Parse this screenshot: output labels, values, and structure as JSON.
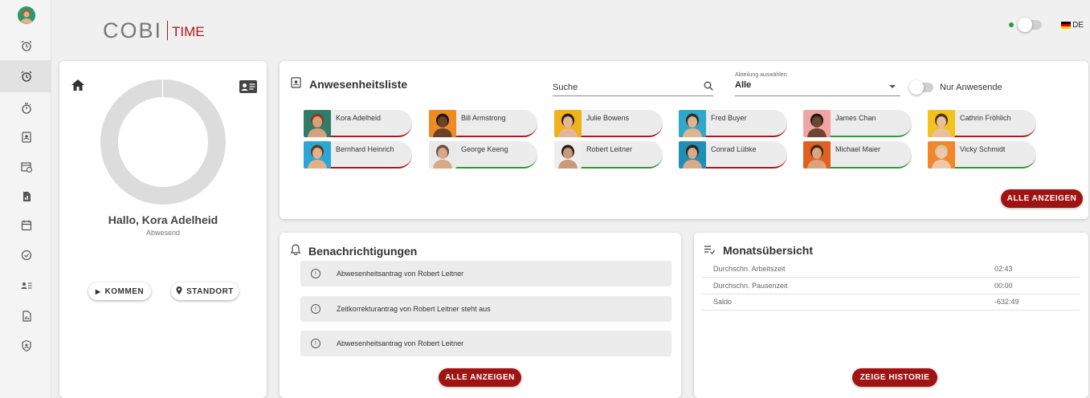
{
  "header": {
    "logo_main": "COBI",
    "logo_sub": "TIME",
    "language": "DE",
    "status_color": "#2e9b3a"
  },
  "sidebar": {
    "items": [
      {
        "icon": "alarm-clock-icon"
      },
      {
        "icon": "alarm-clock-icon",
        "active": true
      },
      {
        "icon": "stopwatch-icon"
      },
      {
        "icon": "contacts-book-icon"
      },
      {
        "icon": "calendar-clock-icon"
      },
      {
        "icon": "report-file-icon"
      },
      {
        "icon": "calendar-icon"
      },
      {
        "icon": "check-circle-icon"
      },
      {
        "icon": "user-list-icon"
      },
      {
        "icon": "chart-file-icon"
      },
      {
        "icon": "shield-user-icon"
      }
    ]
  },
  "profile": {
    "greeting": "Hallo, Kora Adelheid",
    "status": "Abwesend",
    "buttons": {
      "come": "KOMMEN",
      "location": "STANDORT"
    }
  },
  "presence": {
    "title": "Anwesenheitsliste",
    "search_placeholder": "Suche",
    "department_caption": "Abteilung auswählen",
    "department_value": "Alle",
    "only_present_label": "Nur Anwesende",
    "show_all": "ALLE ANZEIGEN",
    "people": [
      {
        "name": "Kora Adelheid",
        "status": "red",
        "bg": "#2e7d6b",
        "skin": "#d9a17a",
        "hair": "#8a3b1a"
      },
      {
        "name": "Bill Armstrong",
        "status": "red",
        "bg": "#f08a24",
        "skin": "#6b4128",
        "hair": "#1a1a1a"
      },
      {
        "name": "Julie Bowens",
        "status": "red",
        "bg": "#f0b21b",
        "skin": "#e3b699",
        "hair": "#2a1f1a"
      },
      {
        "name": "Fred Buyer",
        "status": "red",
        "bg": "#2fa8c9",
        "skin": "#e0b48f",
        "hair": "#3a2a1f"
      },
      {
        "name": "James Chan",
        "status": "green",
        "bg": "#f2a3a3",
        "skin": "#6e4630",
        "hair": "#1a1a1a"
      },
      {
        "name": "Cathrin Fröhlich",
        "status": "red",
        "bg": "#f4c21d",
        "skin": "#e8c0a0",
        "hair": "#4a3322"
      },
      {
        "name": "Bernhard Heinrich",
        "status": "red",
        "bg": "#2aa7d8",
        "skin": "#e2b08a",
        "hair": "#5a3a22"
      },
      {
        "name": "George Keeng",
        "status": "green",
        "bg": "#e9e9e9",
        "skin": "#d9a887",
        "hair": "#6a5040"
      },
      {
        "name": "Robert Leitner",
        "status": "green",
        "bg": "#eeeeee",
        "skin": "#c99a78",
        "hair": "#2a1f1a"
      },
      {
        "name": "Conrad Lübke",
        "status": "red",
        "bg": "#1f8fb8",
        "skin": "#d9aa88",
        "hair": "#2f2018"
      },
      {
        "name": "Michael Maier",
        "status": "green",
        "bg": "#e2601f",
        "skin": "#dca47e",
        "hair": "#3a2a1e"
      },
      {
        "name": "Vicky Schmidt",
        "status": "green",
        "bg": "#f1862a",
        "skin": "#ecc7a8",
        "hair": "#d8c49a"
      }
    ]
  },
  "notifications": {
    "title": "Benachrichtigungen",
    "items": [
      "Abwesenheitsantrag von Robert Leitner",
      "Zeitkorrekturantrag von Robert Leitner steht aus",
      "Abwesenheitsantrag von Robert Leitner"
    ],
    "show_all": "ALLE ANZEIGEN"
  },
  "monthly": {
    "title": "Monatsübersicht",
    "rows": [
      {
        "label": "Durchschn. Arbeitszeit",
        "value": "02:43"
      },
      {
        "label": "Durchschn. Pausenzeit",
        "value": "00:00"
      },
      {
        "label": "Saldo",
        "value": "-632:49"
      }
    ],
    "history_button": "ZEIGE HISTORIE"
  }
}
